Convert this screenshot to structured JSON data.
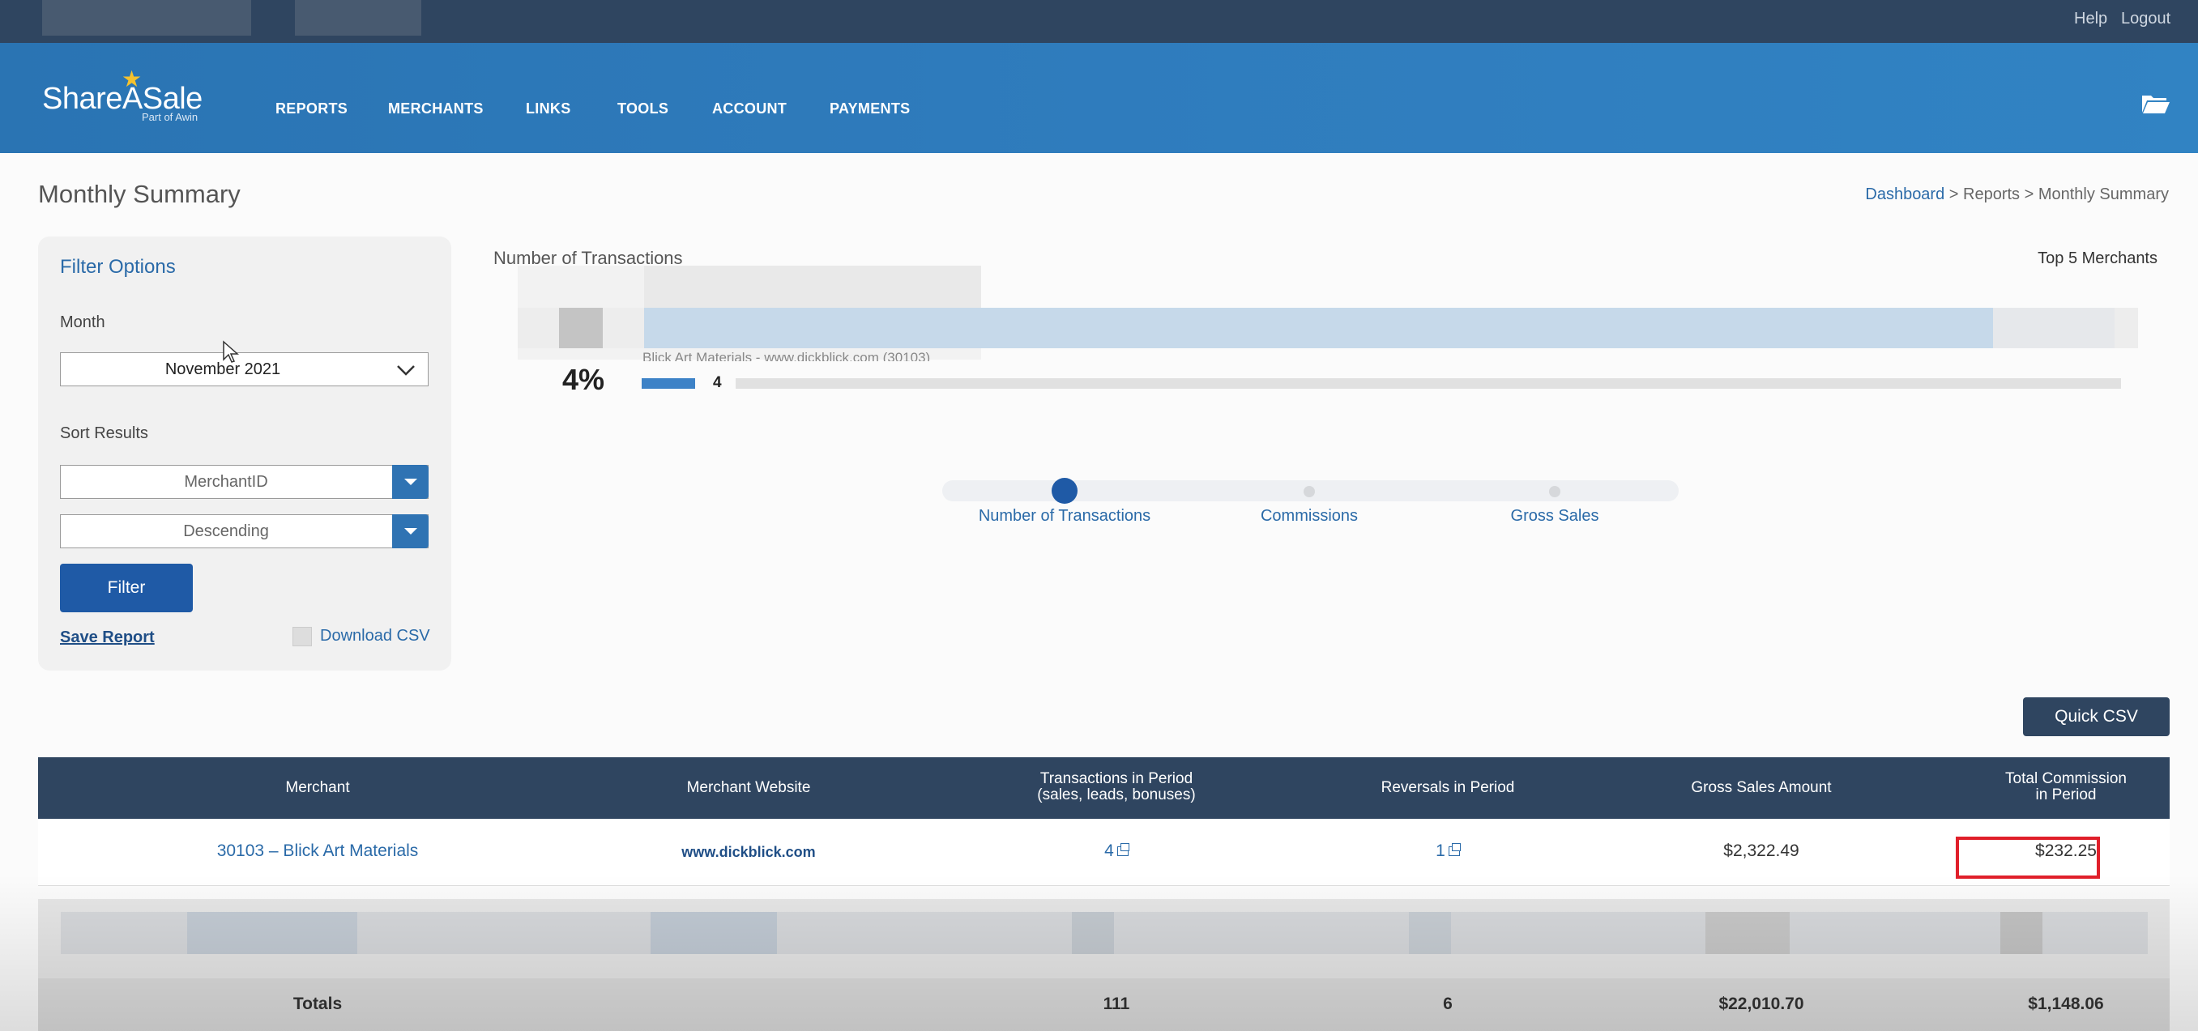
{
  "topbar": {
    "help": "Help",
    "logout": "Logout"
  },
  "brand": {
    "name": "ShareASale",
    "sub": "Part of Awin"
  },
  "nav": {
    "items": [
      "REPORTS",
      "MERCHANTS",
      "LINKS",
      "TOOLS",
      "ACCOUNT",
      "PAYMENTS"
    ]
  },
  "page": {
    "title": "Monthly Summary"
  },
  "breadcrumb": {
    "home": "Dashboard",
    "sep": " > ",
    "reports": "Reports",
    "current": "Monthly Summary"
  },
  "filter": {
    "title": "Filter Options",
    "month_label": "Month",
    "month_value": "November 2021",
    "sort_label": "Sort Results",
    "sort_by": "MerchantID",
    "sort_order": "Descending",
    "filter_button": "Filter",
    "save_report": "Save Report",
    "download_csv": "Download CSV"
  },
  "chart": {
    "title": "Number of Transactions",
    "top5_label": "Top 5 Merchants",
    "percent": "4%",
    "merchant": "Blick Art Materials - www.dickblick.com (30103)",
    "value": "4",
    "value_fraction": 0.036,
    "slider": [
      "Number of Transactions",
      "Commissions",
      "Gross Sales"
    ]
  },
  "quick_csv": "Quick CSV",
  "table": {
    "headers": [
      "Merchant",
      "Merchant Website",
      "Transactions in Period",
      "(sales, leads, bonuses)",
      "Reversals in Period",
      "Gross Sales Amount",
      "Total Commission",
      "in Period"
    ],
    "row": {
      "merchant": "30103 – Blick Art Materials",
      "website": "www.dickblick.com",
      "transactions": "4",
      "reversals": "1",
      "gross_sales": "$2,322.49",
      "commission": "$232.25"
    },
    "totals": {
      "label": "Totals",
      "transactions": "111",
      "reversals": "6",
      "gross_sales": "$22,010.70",
      "commission": "$1,148.06"
    }
  },
  "colors": {
    "topbar": "#2f4560",
    "nav": "#2f7cbd",
    "accent": "#1f5aa6",
    "highlight": "#e01f2a"
  }
}
